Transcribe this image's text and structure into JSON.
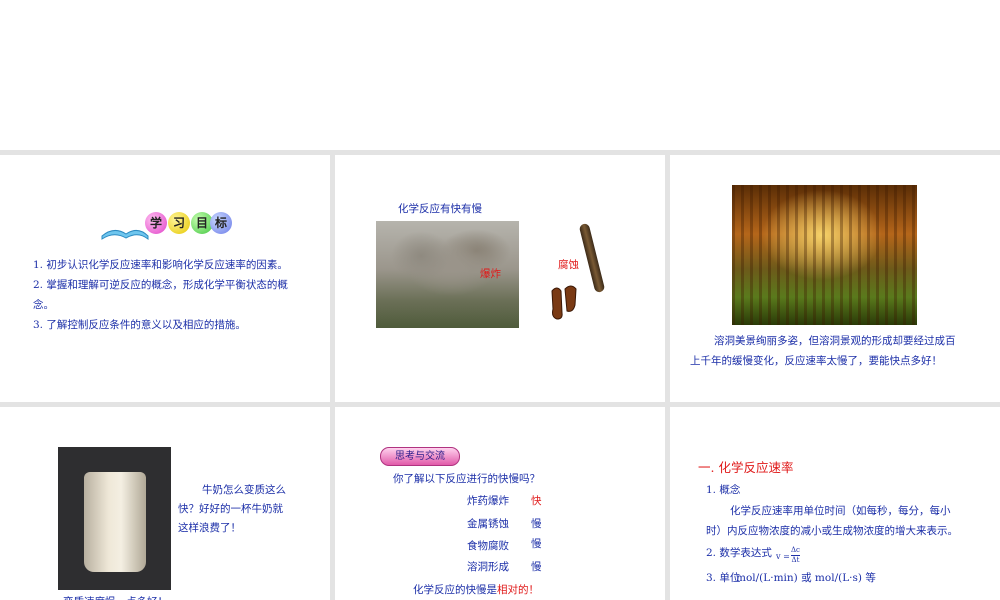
{
  "slide1": {
    "banner_chars": [
      "学",
      "习",
      "目",
      "标"
    ],
    "items": [
      "1. 初步认识化学反应速率和影响化学反应速率的因素。",
      "2. 掌握和理解可逆反应的概念，形成化学平衡状态的概",
      "念。",
      "3. 了解控制反应条件的意义以及相应的措施。"
    ]
  },
  "slide2": {
    "title": "化学反应有快有慢",
    "explosion_label": "爆炸",
    "corrosion_label": "腐蚀"
  },
  "slide3": {
    "caption_line1": "溶洞美景绚丽多姿，但溶洞景观的形成却要经过成百",
    "caption_line2": "上千年的缓慢变化，反应速率太慢了，要能快点多好！"
  },
  "slide4": {
    "line1": "牛奶怎么变质这么",
    "line2": "快？好好的一杯牛奶就",
    "line3": "这样浪费了！",
    "bottom_partial": "变质速度慢一点多好！"
  },
  "slide5": {
    "pill_label": "思考与交流",
    "question": "你了解以下反应进行的快慢吗？",
    "rows": [
      {
        "name": "炸药爆炸",
        "speed": "快"
      },
      {
        "name": "金属锈蚀",
        "speed": "慢"
      },
      {
        "name": "食物腐败",
        "speed": "慢"
      },
      {
        "name": "溶洞形成",
        "speed": "慢"
      }
    ],
    "conclusion_prefix": "化学反应的快慢是",
    "conclusion_emph": "相对的！"
  },
  "slide6": {
    "heading": "一. 化学反应速率",
    "concept_label": "1. 概念",
    "concept_line1": "化学反应速率用单位时间（如每秒，每分，每小",
    "concept_line2": "时）内反应物浓度的减小或生成物浓度的增大来表示。",
    "formula_label": "2. 数学表达式",
    "formula_lhs": "v =",
    "formula_num": "Δc",
    "formula_den": "Δt",
    "unit_label": "3. 单位",
    "unit_value": "mol/(L·min) 或  mol/(L·s) 等"
  },
  "colors": {
    "text_blue": "#1c2fa8",
    "text_red": "#e01919",
    "gutter": "#e3e3e3"
  }
}
